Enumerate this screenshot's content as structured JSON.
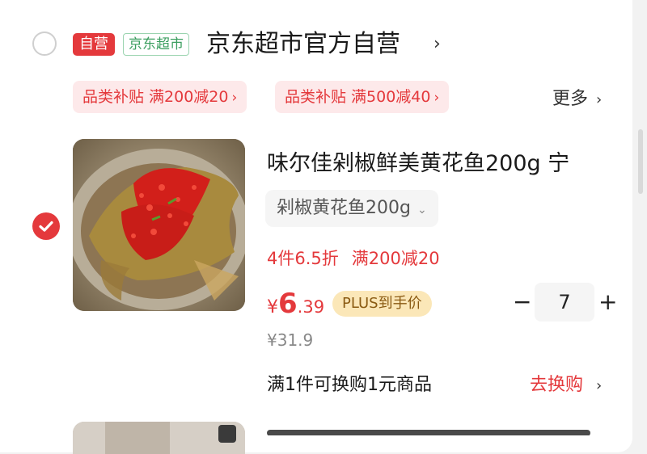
{
  "store": {
    "badge_self": "自营",
    "badge_store": "京东超市",
    "name": "京东超市官方自营",
    "arrow": "›"
  },
  "promos": [
    {
      "label": "品类补贴 满200减20",
      "arrow": "›"
    },
    {
      "label": "品类补贴 满500减40",
      "arrow": "›"
    }
  ],
  "more": {
    "label": "更多",
    "arrow": "›"
  },
  "product": {
    "image_icon": "braised-yellow-croaker-photo",
    "title": "味尔佳剁椒鲜美黄花鱼200g 宁",
    "spec": "剁椒黄花鱼200g",
    "spec_arrow": "⌄",
    "discount": "4件6.5折",
    "full_reduce": "满200减20",
    "price_currency": "¥",
    "price_int": "6",
    "price_dec": ".39",
    "plus_badge": "PLUS到手价",
    "original_price": "¥31.9",
    "quantity": "7",
    "minus": "−",
    "plus": "+",
    "exchange_text": "满1件可换购1元商品",
    "exchange_link": "去换购",
    "exchange_arrow": "›",
    "selected": true
  },
  "colors": {
    "accent": "#e4393c",
    "store_green": "#3b9e5f",
    "plus_gold": "#fbe7b8"
  }
}
